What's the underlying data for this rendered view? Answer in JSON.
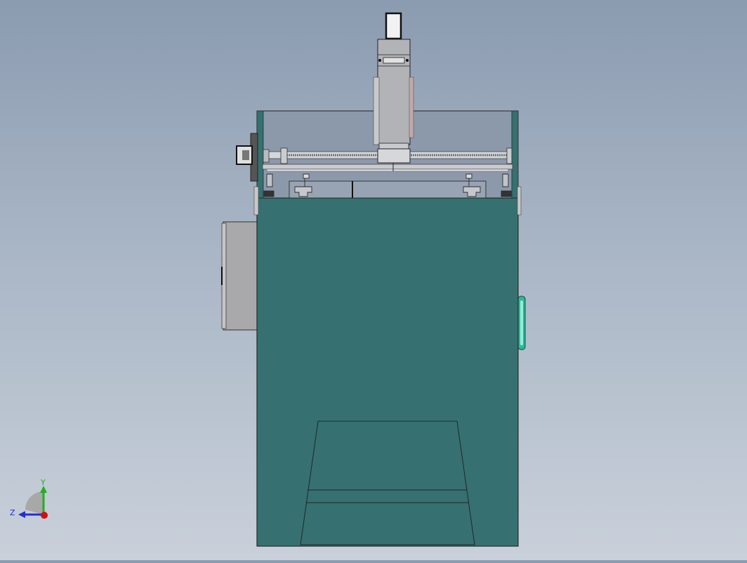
{
  "view": {
    "background_top": "#8b9bb0",
    "background_bottom": "#c9d0da",
    "body_color": "#377070",
    "metal_color": "#a8abb0",
    "glass_color": "#8c99ab",
    "knob_color": "#2fb89a"
  },
  "triad": {
    "y_label": "Y",
    "z_label": "Z",
    "x_color": "#d01010",
    "y_color": "#20b020",
    "z_color": "#2030d0"
  }
}
